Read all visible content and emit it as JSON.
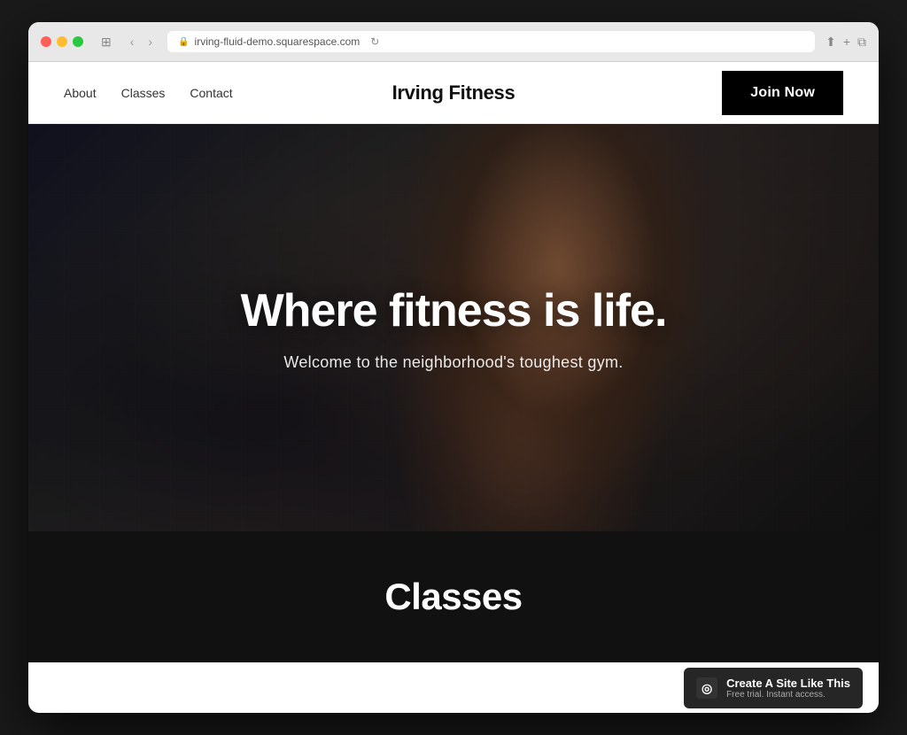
{
  "browser": {
    "url": "irving-fluid-demo.squarespace.com",
    "tab_icon": "🔒"
  },
  "nav": {
    "links": [
      {
        "label": "About",
        "id": "about"
      },
      {
        "label": "Classes",
        "id": "classes"
      },
      {
        "label": "Contact",
        "id": "contact"
      }
    ],
    "site_title": "Irving Fitness",
    "cta_label": "Join Now"
  },
  "hero": {
    "title": "Where fitness is life.",
    "subtitle": "Welcome to the neighborhood's toughest gym."
  },
  "classes_section": {
    "title": "Classes"
  },
  "squarespace_badge": {
    "logo_text": "◎",
    "main_text": "Create A Site Like This",
    "sub_text": "Free trial. Instant access."
  }
}
